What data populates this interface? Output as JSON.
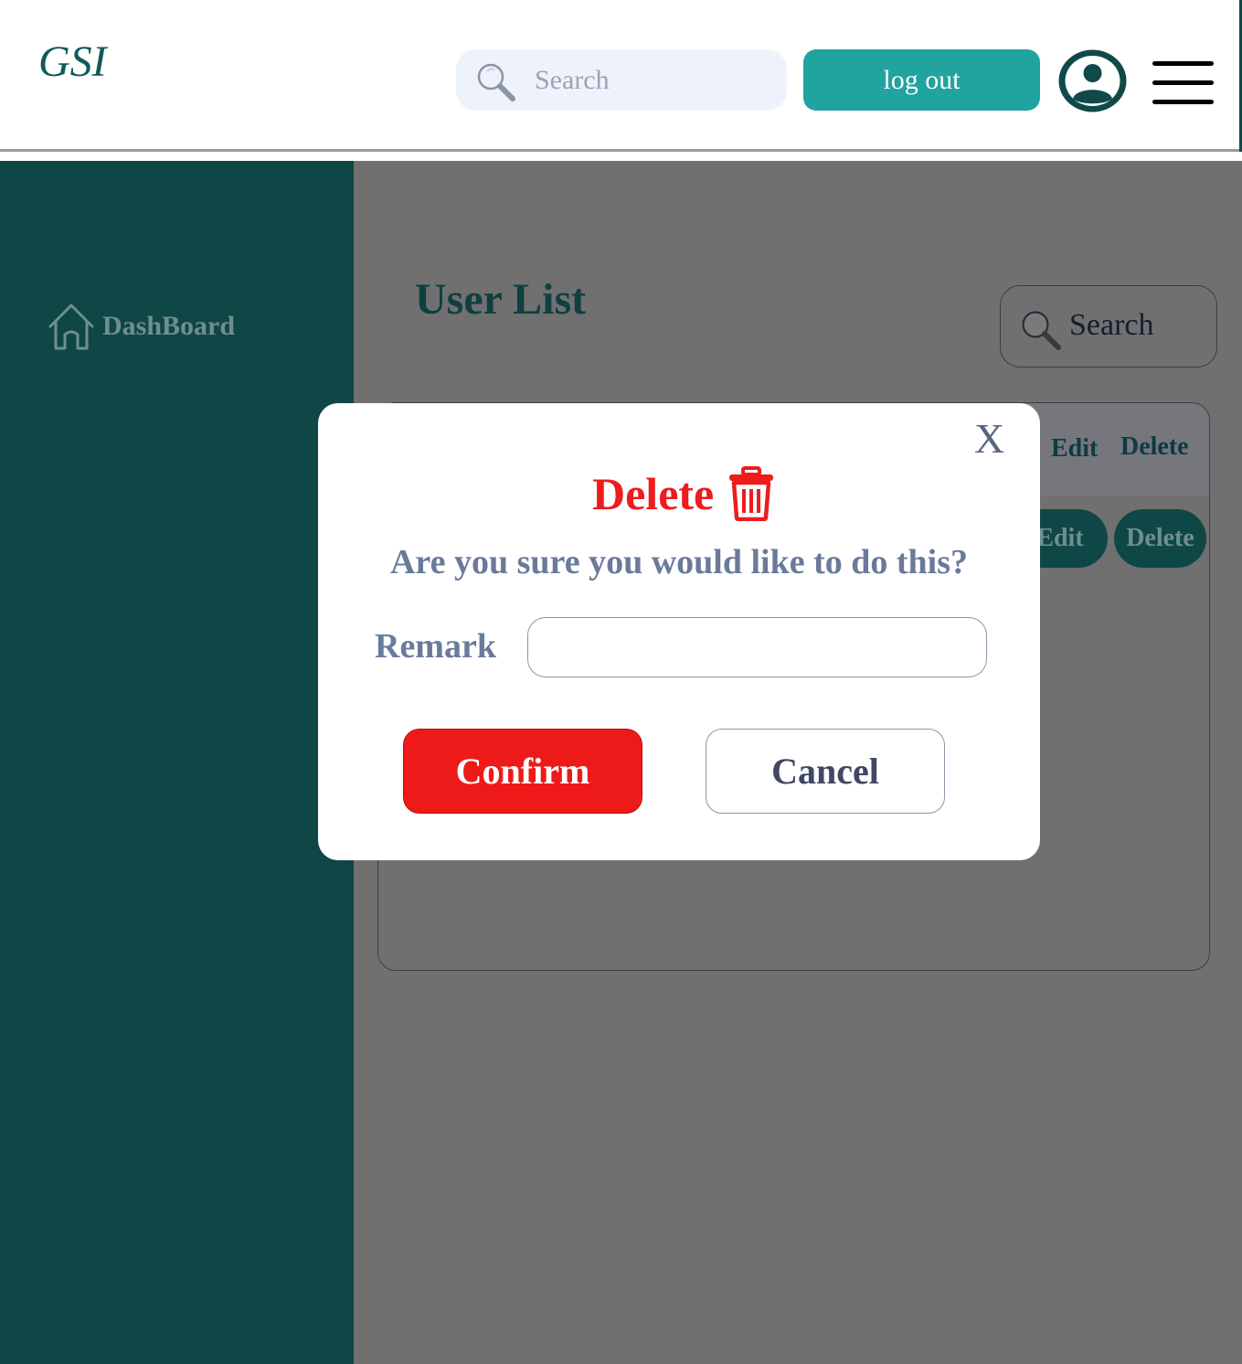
{
  "header": {
    "logo": "GSI",
    "search_placeholder": "Search",
    "logout_label": "log out",
    "icons": {
      "search": "search-icon",
      "avatar": "user-avatar-icon",
      "menu": "hamburger-menu-icon"
    }
  },
  "sidebar": {
    "items": [
      {
        "label": "DashBoard",
        "icon": "home-icon"
      }
    ]
  },
  "main": {
    "title": "User List",
    "search_placeholder": "Search",
    "table": {
      "headers": [
        "Edit",
        "Delete"
      ],
      "rows": [
        {
          "edit_label": "Edit",
          "delete_label": "Delete"
        }
      ]
    }
  },
  "modal": {
    "close_label": "X",
    "title": "Delete",
    "title_icon": "trash-icon",
    "question": "Are you sure you would like to do this?",
    "remark_label": "Remark",
    "remark_value": "",
    "confirm_label": "Confirm",
    "cancel_label": "Cancel"
  },
  "colors": {
    "brand_teal": "#0f4746",
    "logout_teal": "#21a3a0",
    "overlay_gray": "#707070",
    "danger_red": "#ee1c1c",
    "muted_slate": "#6a7a9b"
  }
}
